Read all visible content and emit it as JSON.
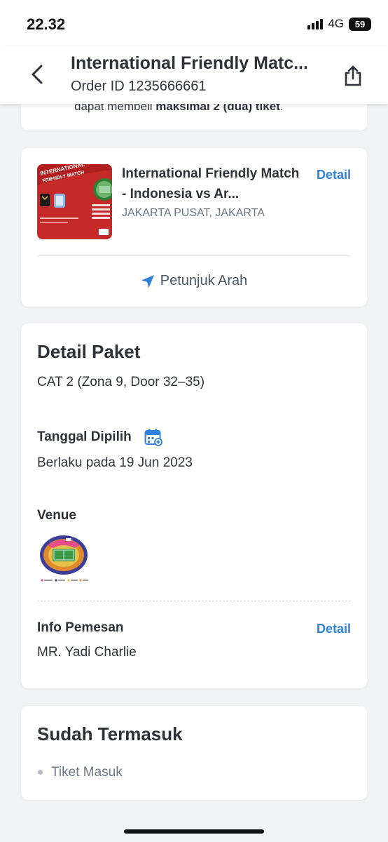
{
  "status": {
    "time": "22.32",
    "network": "4G",
    "battery": "59"
  },
  "header": {
    "title": "International Friendly Matc...",
    "order_id": "Order ID 1235666661"
  },
  "notice": {
    "prefix": "dapat membeli ",
    "bold": "maksimal 2 (dua) tiket",
    "suffix": "."
  },
  "event": {
    "title": "International Friendly Match - Indonesia vs Ar...",
    "location": "JAKARTA PUSAT, JAKARTA",
    "detail_link": "Detail",
    "directions": "Petunjuk Arah"
  },
  "package": {
    "title": "Detail Paket",
    "category": "CAT 2 (Zona 9, Door 32–35)",
    "date_label": "Tanggal Dipilih",
    "date_value": "Berlaku pada 19 Jun 2023",
    "venue_label": "Venue",
    "order_info_label": "Info Pemesan",
    "order_info_detail": "Detail",
    "order_name": "MR. Yadi Charlie"
  },
  "included": {
    "title": "Sudah Termasuk",
    "items": [
      "Tiket Masuk"
    ]
  },
  "colors": {
    "accent": "#2f80d8",
    "thumb_red": "#c62a28"
  }
}
